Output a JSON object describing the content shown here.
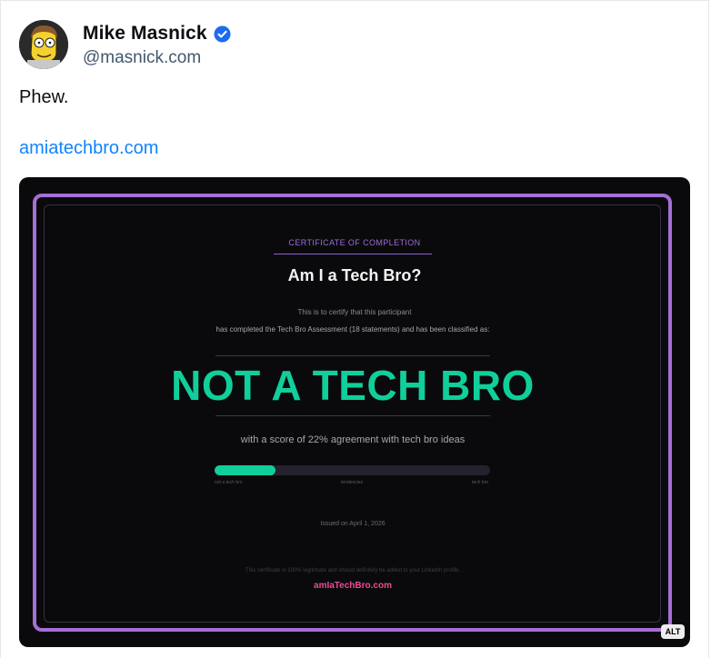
{
  "post": {
    "author_name": "Mike Masnick",
    "handle": "@masnick.com",
    "text": "Phew.",
    "link_text": "amiatechbro.com"
  },
  "icons": {
    "avatar": "cartoon-avatar-icon",
    "verified": "verified-check-icon"
  },
  "colors": {
    "link": "#1083fe",
    "verified": "#1d6cf0",
    "certificate_border": "#a56fd6",
    "result": "#10cf9b",
    "site": "#ec4c93"
  },
  "certificate": {
    "label": "CERTIFICATE OF COMPLETION",
    "title": "Am I a Tech Bro?",
    "certify_line": "This is to certify that this participant",
    "completed_line": "has completed the Tech Bro Assessment (18 statements) and has been classified as:",
    "result": "NOT A TECH BRO",
    "score_line": "with a score of 22% agreement with tech bro ideas",
    "score_fraction": 0.22,
    "scale_left": "not a tech bro",
    "scale_middle": "tendencies",
    "scale_right": "tech bro",
    "issued": "Issued on April 1, 2026",
    "disclaimer": "This certificate is 100% legitimate and should definitely be added to your LinkedIn profile.",
    "site": "amIaTechBro.com"
  },
  "alt_badge": "ALT"
}
